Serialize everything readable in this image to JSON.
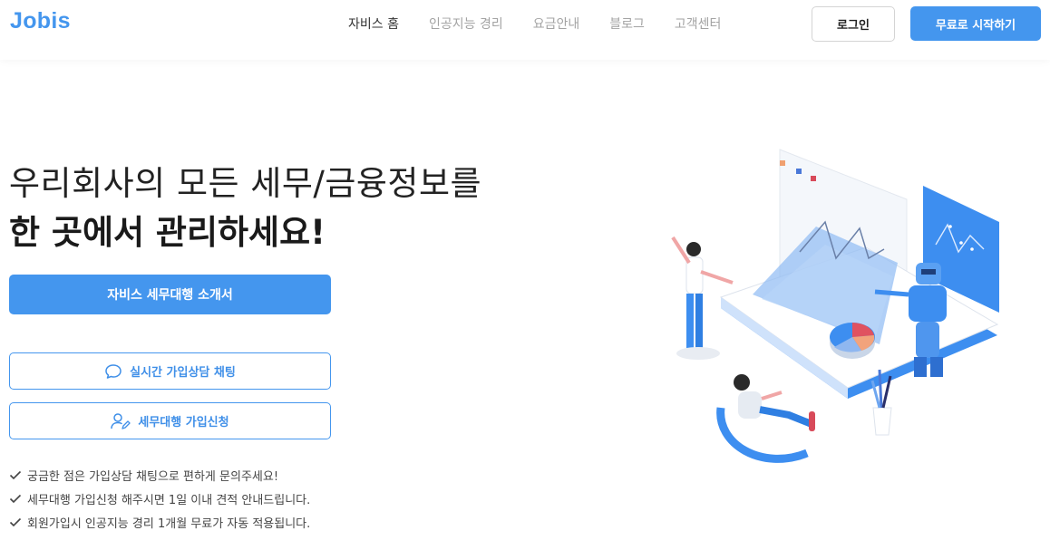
{
  "brand": {
    "logo": "Jobis"
  },
  "nav": {
    "items": [
      {
        "label": "자비스 홈",
        "active": true
      },
      {
        "label": "인공지능 경리",
        "active": false
      },
      {
        "label": "요금안내",
        "active": false
      },
      {
        "label": "블로그",
        "active": false
      },
      {
        "label": "고객센터",
        "active": false
      }
    ]
  },
  "header": {
    "login_label": "로그인",
    "start_label": "무료로 시작하기"
  },
  "hero": {
    "line1": "우리회사의 모든 세무/금융정보를",
    "line2": "한 곳에서 관리하세요!",
    "intro_button": "자비스 세무대행 소개서",
    "chat_button": "실시간 가입상담 채팅",
    "apply_button": "세무대행 가입신청",
    "checks": [
      "궁금한 점은 가입상담 채팅으로 편하게 문의주세요!",
      "세무대행 가입신청 해주시면 1일 이내 견적 안내드립니다.",
      "회원가입시 인공지능 경리 1개월 무료가 자동 적용됩니다."
    ]
  },
  "icons": {
    "chat": "chat-bubble-icon",
    "apply": "user-edit-icon",
    "check": "checkmark-icon"
  },
  "colors": {
    "accent": "#4496ee",
    "text": "#222222",
    "muted": "#a3a3a3"
  }
}
